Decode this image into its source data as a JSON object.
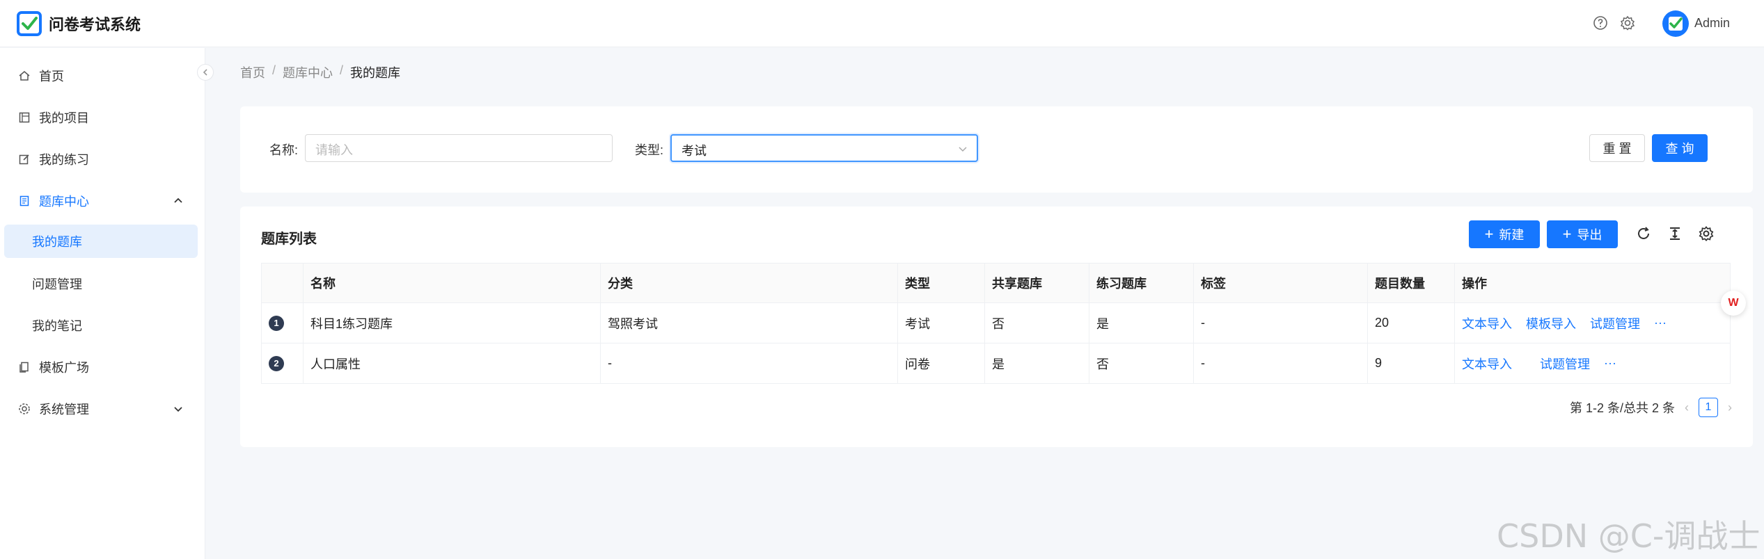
{
  "app": {
    "title": "问卷考试系统",
    "username": "Admin"
  },
  "sidebar": {
    "items": [
      {
        "label": "首页",
        "icon": "home-icon"
      },
      {
        "label": "我的项目",
        "icon": "project-icon"
      },
      {
        "label": "我的练习",
        "icon": "edit-icon"
      },
      {
        "label": "题库中心",
        "icon": "book-icon",
        "expanded": true,
        "children": [
          {
            "label": "我的题库",
            "selected": true
          },
          {
            "label": "问题管理"
          },
          {
            "label": "我的笔记"
          }
        ]
      },
      {
        "label": "模板广场",
        "icon": "template-icon"
      },
      {
        "label": "系统管理",
        "icon": "gear-icon",
        "expanded": false
      }
    ]
  },
  "breadcrumb": {
    "items": [
      "首页",
      "题库中心",
      "我的题库"
    ],
    "separator": "/"
  },
  "search": {
    "name_label": "名称:",
    "name_placeholder": "请输入",
    "type_label": "类型:",
    "type_value": "考试",
    "reset_label": "重 置",
    "query_label": "查 询"
  },
  "table_card": {
    "title": "题库列表",
    "new_label": "新建",
    "export_label": "导出",
    "columns": [
      "",
      "名称",
      "分类",
      "类型",
      "共享题库",
      "练习题库",
      "标签",
      "题目数量",
      "操作"
    ],
    "rows": [
      {
        "index": "1",
        "name": "科目1练习题库",
        "category": "驾照考试",
        "type": "考试",
        "shared": "否",
        "practice": "是",
        "tag": "-",
        "count": "20",
        "ops": [
          "文本导入",
          "模板导入",
          "试题管理",
          "···"
        ]
      },
      {
        "index": "2",
        "name": "人口属性",
        "category": "-",
        "type": "问卷",
        "shared": "是",
        "practice": "否",
        "tag": "-",
        "count": "9",
        "ops": [
          "文本导入",
          "试题管理",
          "···"
        ]
      }
    ],
    "pagination": {
      "summary": "第 1-2 条/总共 2 条",
      "current": "1"
    }
  },
  "watermark": "CSDN @C-调战士",
  "colors": {
    "primary": "#1677ff",
    "selected_bg": "#e6f0fd"
  }
}
